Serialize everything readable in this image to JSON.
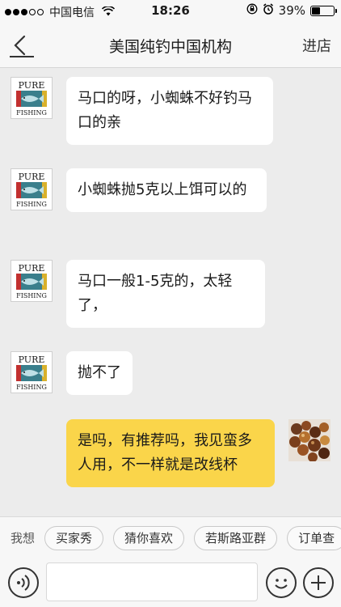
{
  "status_bar": {
    "carrier": "中国电信",
    "time": "18:26",
    "battery_percent": "39%",
    "battery_level": 0.39,
    "signal_bars_filled": 3,
    "signal_bars_total": 5
  },
  "nav": {
    "title": "美国纯钓中国机构",
    "enter_shop": "进店"
  },
  "messages": [
    {
      "from": "shop",
      "text": "马口的呀，小蜘蛛不好钓马口的亲"
    },
    {
      "from": "shop",
      "text": "小蜘蛛抛5克以上饵可以的"
    },
    {
      "from": "shop",
      "text": "马口一般1-5克的，太轻了，"
    },
    {
      "from": "shop",
      "text": "抛不了"
    },
    {
      "from": "me",
      "text": "是吗，有推荐吗，我见蛮多人用，不一样就是改线杯"
    }
  ],
  "shop_avatar": {
    "logo_top": "PURE",
    "logo_bottom": "FISHING"
  },
  "quick_bar": {
    "label": "我想",
    "chips": [
      "买家秀",
      "猜你喜欢",
      "若斯路亚群",
      "订单查"
    ]
  },
  "input": {
    "placeholder": ""
  },
  "colors": {
    "my_bubble": "#fad54a",
    "shop_bubble": "#ffffff",
    "background": "#ececec"
  }
}
